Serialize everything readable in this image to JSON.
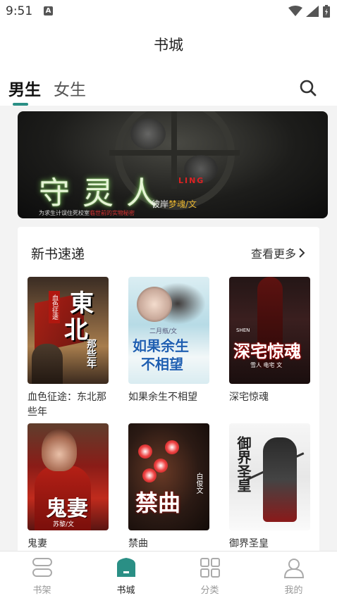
{
  "status_bar": {
    "time": "9:51",
    "notification_icon": "A"
  },
  "header": {
    "title": "书城"
  },
  "tabs": [
    {
      "label": "男生",
      "active": true
    },
    {
      "label": "女生",
      "active": false
    }
  ],
  "banner": {
    "title": "守灵人",
    "subtitle": "LING",
    "author_prefix": "彼岸",
    "author_highlight": "梦魂/文",
    "slogan_prefix": "为求生计误住死校室",
    "slogan_highlight": "临世前的实物秘密"
  },
  "section": {
    "title": "新书速递",
    "more_label": "查看更多"
  },
  "books": [
    {
      "name": "血色征途：东北那些年",
      "cover_text": [
        "東",
        "北",
        "那些年"
      ],
      "cover_seal": "血色征途"
    },
    {
      "name": "如果余生不相望",
      "cover_text": [
        "如果余生",
        "不相望"
      ],
      "cover_author": "二月瓶/文"
    },
    {
      "name": "深宅惊魂",
      "cover_text": [
        "深宅惊魂"
      ],
      "cover_sub": "SHEN",
      "cover_author": "雪人 电宅 文"
    },
    {
      "name": "鬼妻",
      "cover_text": [
        "鬼妻"
      ],
      "cover_author": "苏黎/文"
    },
    {
      "name": "禁曲",
      "cover_text": [
        "禁曲"
      ],
      "cover_author": "白俊文"
    },
    {
      "name": "御界圣皇",
      "cover_text": [
        "御界圣皇"
      ]
    }
  ],
  "bottom_nav": [
    {
      "label": "书架",
      "icon": "bookshelf-icon",
      "active": false
    },
    {
      "label": "书城",
      "icon": "bookstore-icon",
      "active": true
    },
    {
      "label": "分类",
      "icon": "category-icon",
      "active": false
    },
    {
      "label": "我的",
      "icon": "profile-icon",
      "active": false
    }
  ],
  "colors": {
    "accent": "#2a8f85",
    "inactive_nav": "#999999"
  }
}
